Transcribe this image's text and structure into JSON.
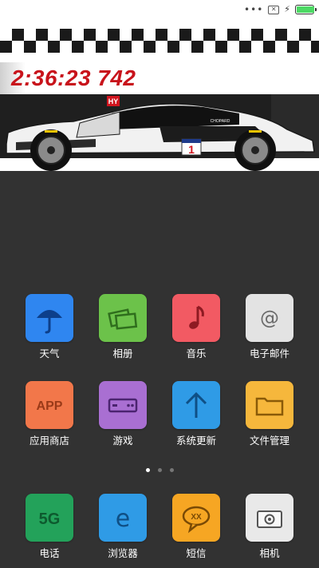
{
  "statusbar": {
    "overflow_glyph": "•••",
    "sim_glyph": "✕",
    "charging_glyph": "⚡",
    "battery_level": 1.0,
    "battery_color": "#4cd964"
  },
  "widget": {
    "time": "2:36:23 742",
    "clock_color": "#c8131b",
    "car_decals": {
      "badge": "HY",
      "sponsor": "CHOPARD",
      "number": "1"
    }
  },
  "apps_page": [
    {
      "label": "天气",
      "icon": "umbrella-icon",
      "color": "#2f86f0",
      "glyph": "☂"
    },
    {
      "label": "相册",
      "icon": "photos-icon",
      "color": "#6cc24a",
      "glyph": "▭"
    },
    {
      "label": "音乐",
      "icon": "music-note-icon",
      "color": "#f25a63",
      "glyph": "♪"
    },
    {
      "label": "电子邮件",
      "icon": "at-sign-icon",
      "color": "#e3e3e3",
      "glyph": "@"
    },
    {
      "label": "应用商店",
      "icon": "app-store-icon",
      "color": "#f2774a",
      "glyph": "APP"
    },
    {
      "label": "游戏",
      "icon": "gamepad-icon",
      "color": "#a96fd2",
      "glyph": "▭"
    },
    {
      "label": "系统更新",
      "icon": "arrow-up-icon",
      "color": "#2f9be6",
      "glyph": "↑"
    },
    {
      "label": "文件管理",
      "icon": "folder-icon",
      "color": "#f6b73c",
      "glyph": "▭"
    }
  ],
  "page_indicator": {
    "count": 3,
    "active": 0
  },
  "dock": [
    {
      "label": "电话",
      "icon": "phone-5g-icon",
      "color": "#23a25a",
      "glyph": "5G"
    },
    {
      "label": "浏览器",
      "icon": "browser-e-icon",
      "color": "#2f9be6",
      "glyph": "e"
    },
    {
      "label": "短信",
      "icon": "message-bubble-icon",
      "color": "#f6a623",
      "glyph": "XX"
    },
    {
      "label": "相机",
      "icon": "camera-icon",
      "color": "#e9e9e9",
      "glyph": "●"
    }
  ]
}
